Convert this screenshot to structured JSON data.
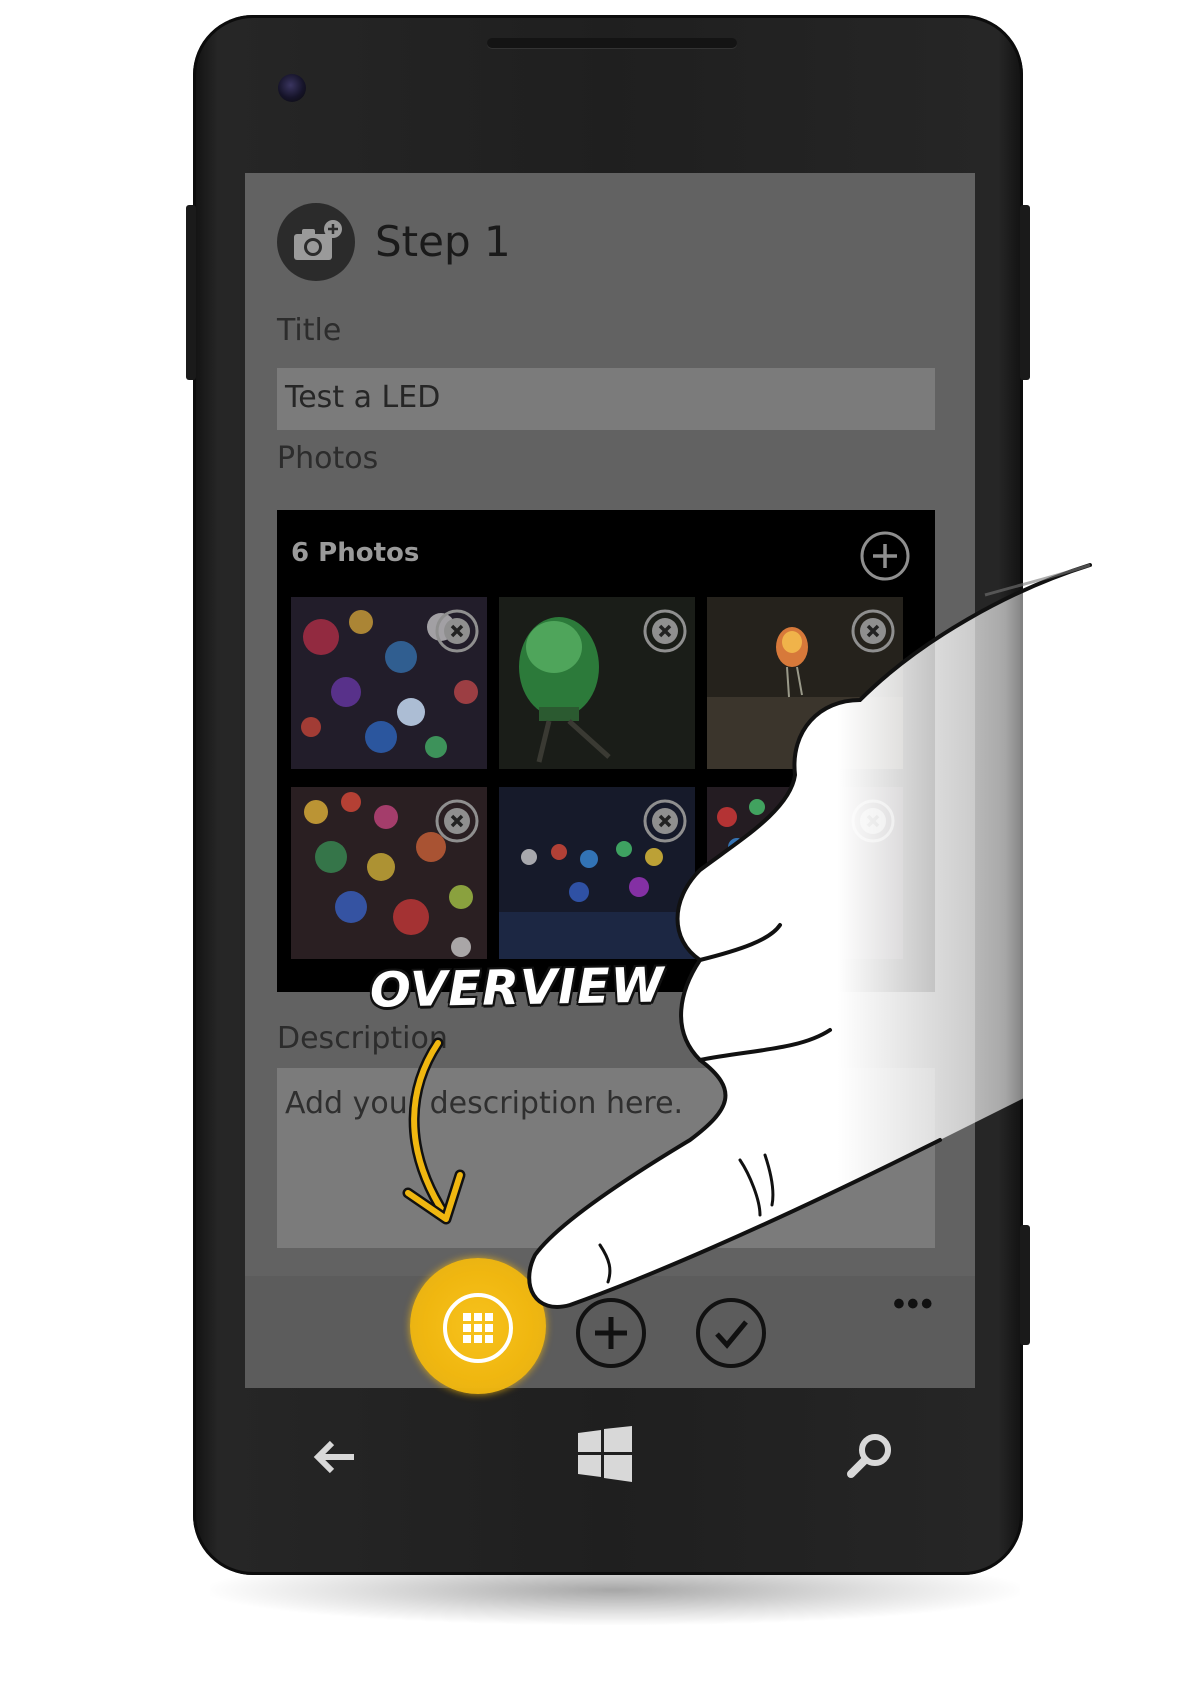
{
  "screen": {
    "step_title": "Step 1",
    "title_label": "Title",
    "title_value": "Test a LED",
    "photos_label": "Photos",
    "photos_count": "6 Photos",
    "description_label": "Description",
    "description_placeholder": "Add your description here."
  },
  "annotation": {
    "label": "OVERVIEW"
  },
  "icons": {
    "step": "camera-add-icon",
    "add_photo": "plus-circle-icon",
    "remove_photo": "close-circle-icon",
    "overview": "grid-icon",
    "add": "plus-icon",
    "confirm": "check-icon",
    "more": "ellipsis-icon",
    "back": "back-arrow-icon",
    "start": "windows-icon",
    "search": "search-icon"
  },
  "colors": {
    "highlight": "#f0b710",
    "screen_bg": "#626262",
    "input_bg": "#7b7b7b"
  }
}
